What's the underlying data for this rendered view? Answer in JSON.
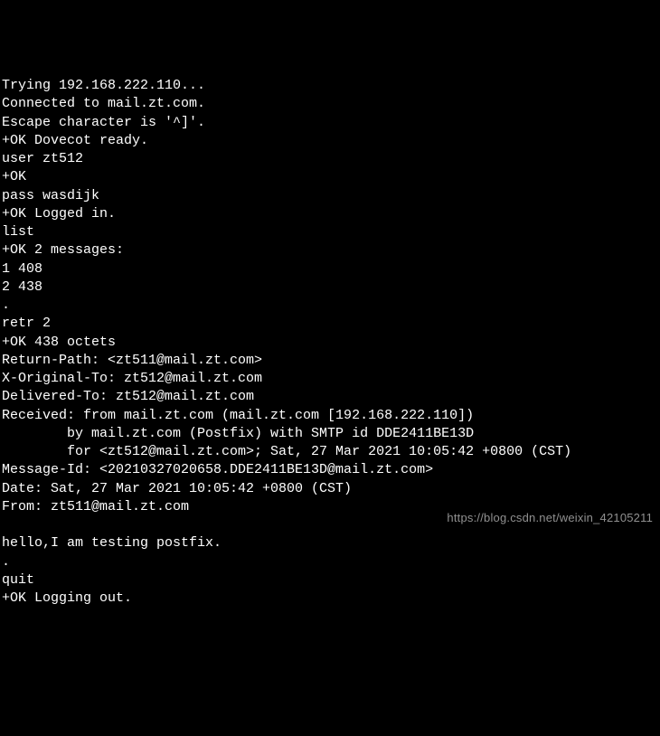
{
  "terminal": {
    "lines": [
      "Trying 192.168.222.110...",
      "Connected to mail.zt.com.",
      "Escape character is '^]'.",
      "+OK Dovecot ready.",
      "user zt512",
      "+OK",
      "pass wasdijk",
      "+OK Logged in.",
      "list",
      "+OK 2 messages:",
      "1 408",
      "2 438",
      ".",
      "retr 2",
      "+OK 438 octets",
      "Return-Path: <zt511@mail.zt.com>",
      "X-Original-To: zt512@mail.zt.com",
      "Delivered-To: zt512@mail.zt.com",
      "Received: from mail.zt.com (mail.zt.com [192.168.222.110])",
      "        by mail.zt.com (Postfix) with SMTP id DDE2411BE13D",
      "        for <zt512@mail.zt.com>; Sat, 27 Mar 2021 10:05:42 +0800 (CST)",
      "Message-Id: <20210327020658.DDE2411BE13D@mail.zt.com>",
      "Date: Sat, 27 Mar 2021 10:05:42 +0800 (CST)",
      "From: zt511@mail.zt.com",
      "",
      "hello,I am testing postfix.",
      ".",
      "quit",
      "+OK Logging out."
    ]
  },
  "watermark": {
    "text": "https://blog.csdn.net/weixin_42105211"
  }
}
